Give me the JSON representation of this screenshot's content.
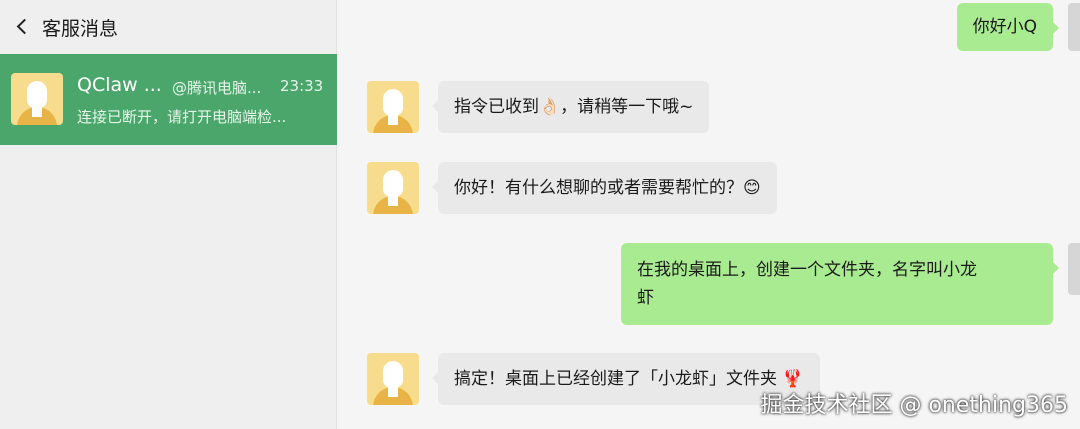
{
  "sidebar": {
    "title": "客服消息",
    "conversation": {
      "name": "QClaw ...",
      "at": "@腾讯电脑...",
      "time": "23:33",
      "preview": "连接已断开，请打开电脑端检..."
    }
  },
  "messages": [
    {
      "side": "out",
      "text": "你好小Q"
    },
    {
      "side": "in",
      "text": "指令已收到👌🏻，请稍等一下哦~"
    },
    {
      "side": "in",
      "text": "你好！有什么想聊的或者需要帮忙的？😊"
    },
    {
      "side": "out",
      "lines": [
        "在我的桌面上，创建一个文件夹，名字叫小龙",
        "虾"
      ]
    },
    {
      "side": "in",
      "text": "搞定！桌面上已经创建了「小龙虾」文件夹 🦞"
    }
  ],
  "watermark": "掘金技术社区 @ onething365",
  "colors": {
    "selected_conversation": "#4aa66a",
    "outgoing_bubble": "#a9eb90",
    "incoming_bubble": "#e9e9e9"
  }
}
